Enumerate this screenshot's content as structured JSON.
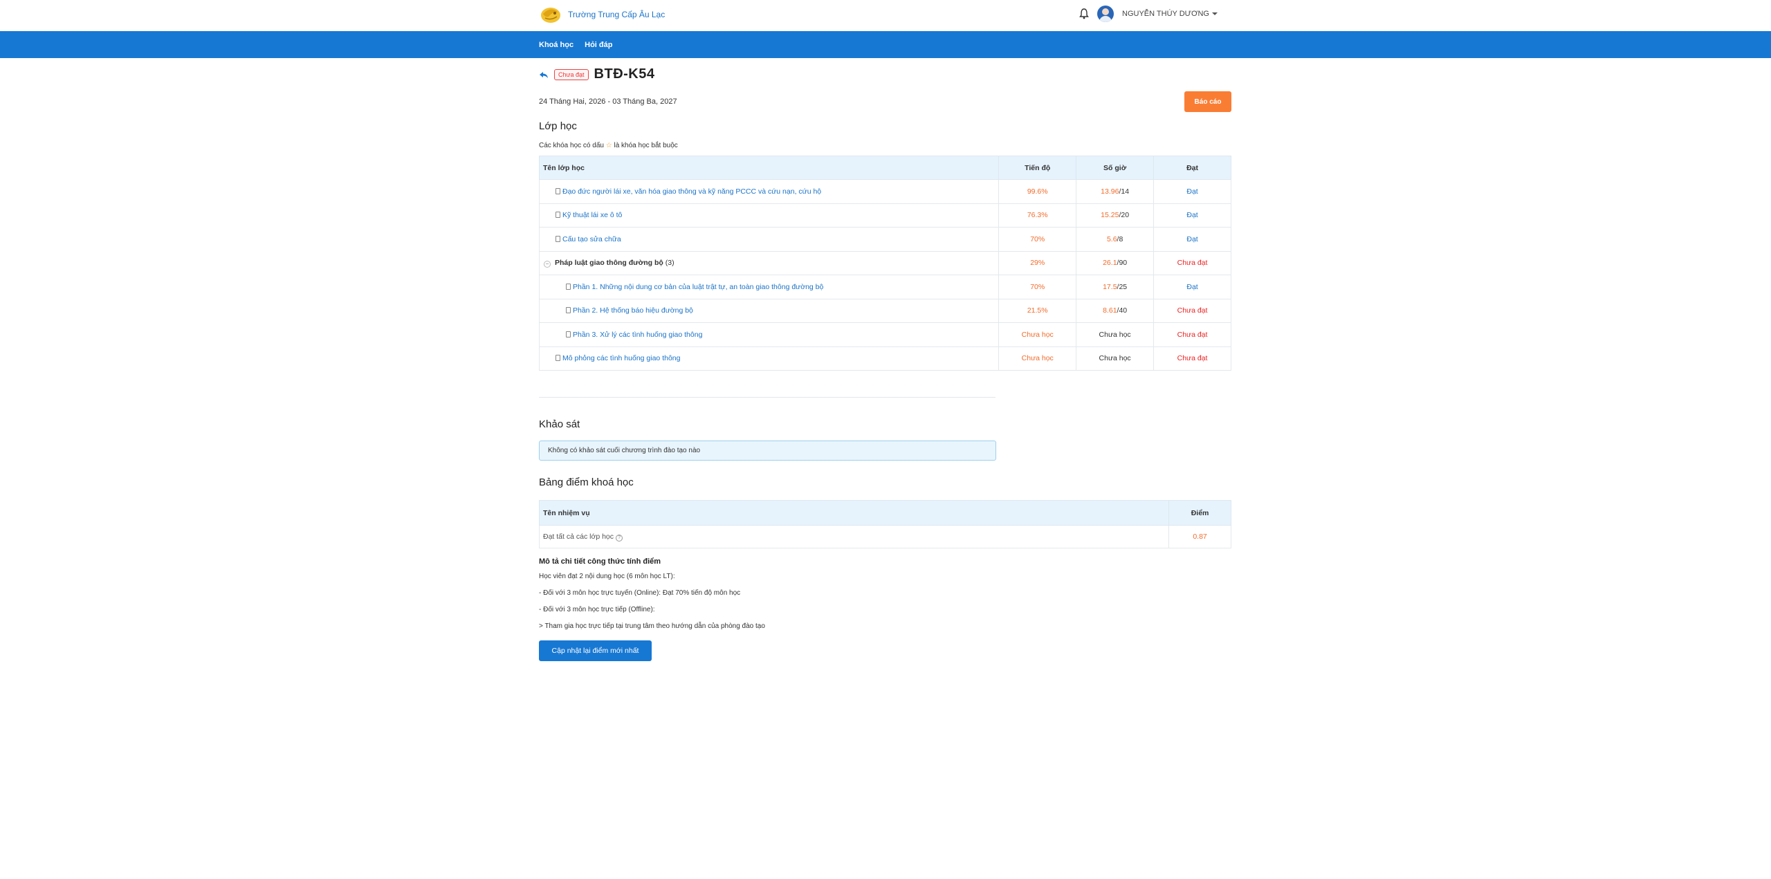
{
  "brand": {
    "name": "Trường Trung Cấp Âu Lạc"
  },
  "user": {
    "name": "NGUYỄN THÚY DƯƠNG"
  },
  "nav": {
    "items": [
      "Khoá học",
      "Hỏi đáp"
    ]
  },
  "course": {
    "status": "Chưa đạt",
    "title": "BTĐ-K54",
    "date_range": "24 Tháng Hai, 2026 - 03 Tháng Ba, 2027",
    "report_label": "Báo cáo"
  },
  "classes": {
    "title": "Lớp học",
    "note_before": "Các khóa học có dấu",
    "note_after": "là khóa học bắt buộc",
    "headers": {
      "name": "Tên lớp học",
      "progress": "Tiến độ",
      "hours": "Số giờ",
      "pass": "Đạt"
    },
    "rows": [
      {
        "name": "Đạo đức người lái xe, văn hóa giao thông và kỹ năng PCCC và cứu nạn, cứu hộ",
        "progress": "99.6%",
        "hours_done": "13.96",
        "hours_total": "/14",
        "pass": "Đạt"
      },
      {
        "name": "Kỹ thuật lái xe ô tô",
        "progress": "76.3%",
        "hours_done": "15.25",
        "hours_total": "/20",
        "pass": "Đạt"
      },
      {
        "name": "Cấu tạo sửa chữa",
        "progress": "70%",
        "hours_done": "5.6",
        "hours_total": "/8",
        "pass": "Đạt"
      },
      {
        "name": "Pháp luật giao thông đường bộ",
        "count": "(3)",
        "progress": "29%",
        "hours_done": "26.1",
        "hours_total": "/90",
        "pass": "Chưa đạt"
      },
      {
        "name": "Phần 1. Những nội dung cơ bản của luật trật tự, an toàn giao thông đường bộ",
        "progress": "70%",
        "hours_done": "17.5",
        "hours_total": "/25",
        "pass": "Đạt"
      },
      {
        "name": "Phần 2. Hệ thống báo hiệu đường bộ",
        "progress": "21.5%",
        "hours_done": "8.61",
        "hours_total": "/40",
        "pass": "Chưa đạt"
      },
      {
        "name": "Phần 3. Xử lý các tình huống giao thông",
        "progress": "Chưa học",
        "hours": "Chưa học",
        "pass": "Chưa đạt"
      },
      {
        "name": "Mô phỏng các tình huống giao thông",
        "progress": "Chưa học",
        "hours": "Chưa học",
        "pass": "Chưa đạt"
      }
    ]
  },
  "survey": {
    "title": "Khảo sát",
    "message": "Không có khảo sát cuối chương trình đào tạo nào"
  },
  "scores": {
    "title": "Bảng điểm khoá học",
    "headers": {
      "task": "Tên nhiệm vụ",
      "score": "Điểm"
    },
    "rows": [
      {
        "task": "Đạt tất cả các lớp học",
        "score": "0.87"
      }
    ]
  },
  "formula": {
    "title": "Mô tả chi tiết công thức tính điểm",
    "lines": [
      "Học viên đạt 2 nội dung học (6 môn học LT):",
      "- Đối với 3 môn học trực tuyến (Online): Đạt 70% tiến độ môn học",
      "- Đối với 3 môn học trực tiếp (Offline):",
      "> Tham gia học trực tiếp tại trung tâm theo hướng dẫn của phòng đào tạo"
    ]
  },
  "update_button": "Cập nhật lại điểm mới nhất",
  "colors": {
    "primary": "#1778d3",
    "accent": "#fa7d34",
    "danger": "#e22222",
    "progress": "#f26b2a"
  }
}
